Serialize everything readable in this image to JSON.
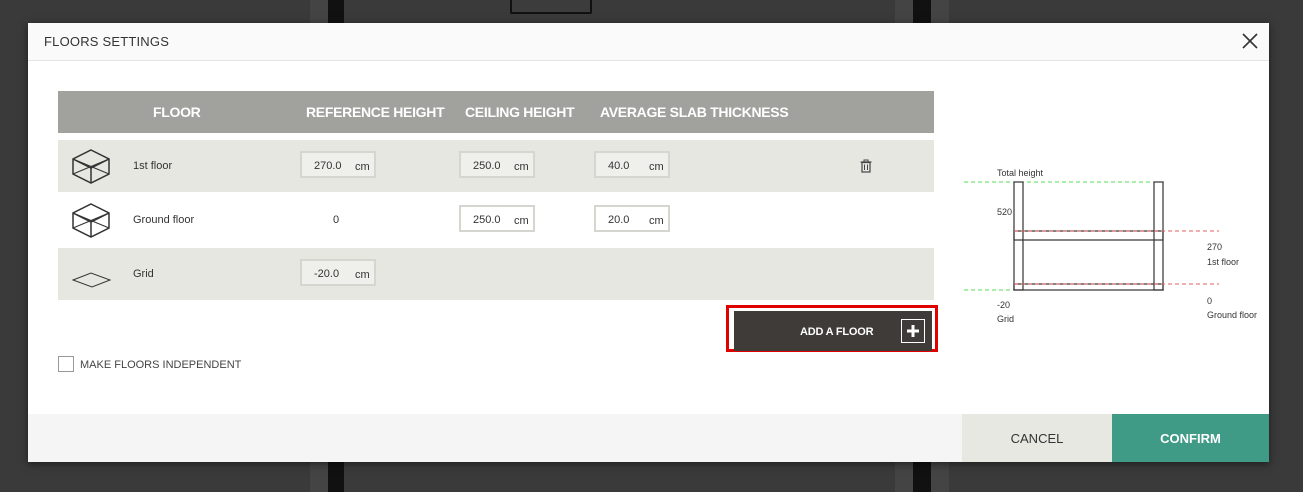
{
  "dialog": {
    "title": "FLOORS SETTINGS",
    "close_icon": "close-icon"
  },
  "table": {
    "headers": [
      "FLOOR",
      "REFERENCE HEIGHT",
      "CEILING HEIGHT",
      "AVERAGE SLAB THICKNESS"
    ],
    "unit": "cm",
    "rows": [
      {
        "name": "1st floor",
        "icon": "box-3d-icon",
        "reference_height": "270.0",
        "ceiling_height": "250.0",
        "slab_thickness": "40.0",
        "deletable": true
      },
      {
        "name": "Ground floor",
        "icon": "box-3d-icon",
        "reference_height": "0",
        "ceiling_height": "250.0",
        "slab_thickness": "20.0",
        "deletable": false
      },
      {
        "name": "Grid",
        "icon": "plane-icon",
        "reference_height": "-20.0",
        "ceiling_height": "",
        "slab_thickness": "",
        "deletable": false
      }
    ]
  },
  "actions": {
    "add_floor_label": "ADD A FLOOR",
    "independent_label": "MAKE FLOORS INDEPENDENT",
    "independent_checked": false,
    "cancel_label": "CANCEL",
    "confirm_label": "CONFIRM"
  },
  "diagram": {
    "total_height_label": "Total height",
    "total_height_value": "520",
    "first_floor_value": "270",
    "first_floor_label": "1st floor",
    "ground_floor_value": "0",
    "ground_floor_label": "Ground floor",
    "grid_value": "-20",
    "grid_label": "Grid"
  },
  "colors": {
    "header_bg": "#a1a29d",
    "row_shaded": "#e7e7e2",
    "confirm_bg": "#3f9a86",
    "add_button_bg": "#3e3b39",
    "highlight": "#e00000",
    "diagram_green_line": "#55dd55",
    "diagram_red_line": "#e06060"
  }
}
